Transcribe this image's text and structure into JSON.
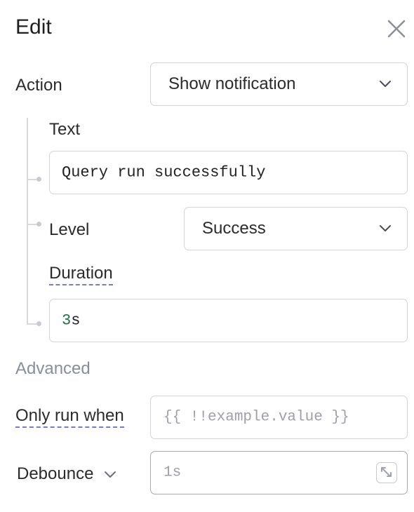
{
  "header": {
    "title": "Edit",
    "close_icon": "close-icon"
  },
  "action": {
    "label": "Action",
    "value": "Show notification"
  },
  "text_field": {
    "label": "Text",
    "value": "Query run successfully"
  },
  "level": {
    "label": "Level",
    "value": "Success"
  },
  "duration": {
    "label": "Duration",
    "value_number": "3",
    "value_unit": "s"
  },
  "advanced": {
    "label": "Advanced"
  },
  "only_run_when": {
    "label": "Only run when",
    "placeholder": "{{ !!example.value }}"
  },
  "debounce": {
    "label": "Debounce",
    "placeholder": "1s",
    "expand_icon": "expand-icon"
  },
  "colors": {
    "accent_underline": "#7b78d8",
    "border": "#d2d4d8",
    "section_label": "#8a8e99"
  }
}
